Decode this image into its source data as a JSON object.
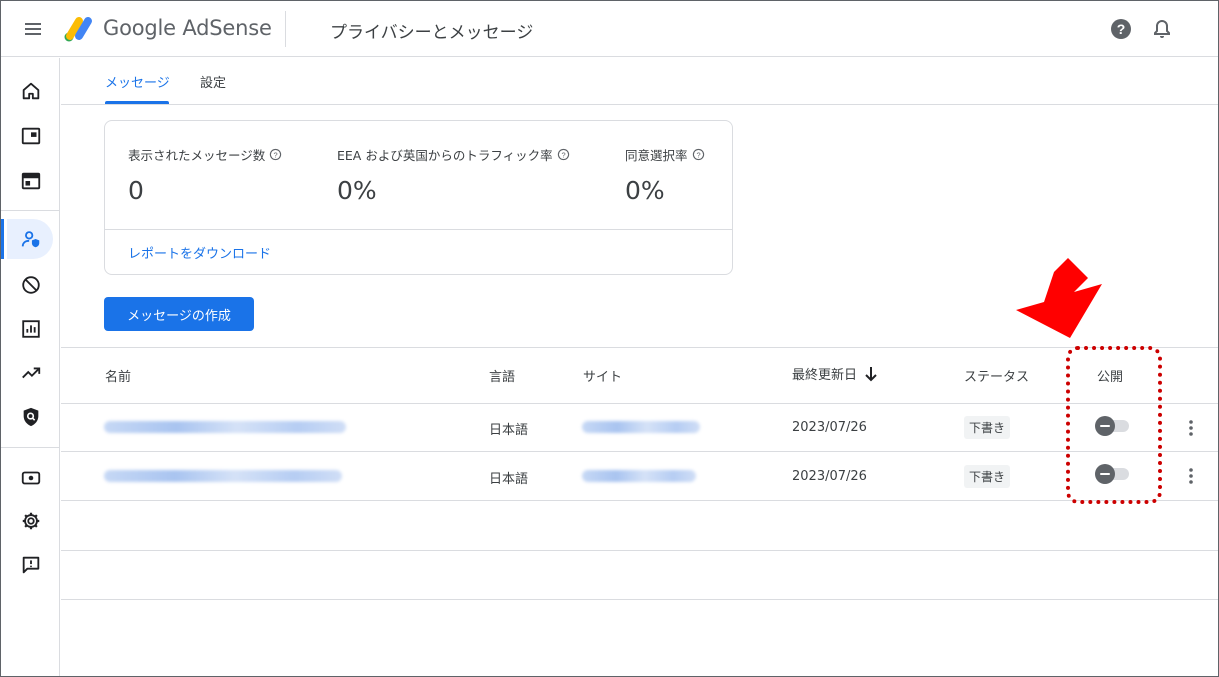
{
  "app": {
    "brand": "Google AdSense",
    "page_title": "プライバシーとメッセージ"
  },
  "tabs": [
    {
      "label": "メッセージ",
      "active": true
    },
    {
      "label": "設定",
      "active": false
    }
  ],
  "rail": {
    "items": [
      "home-icon",
      "ads-icon",
      "sites-icon",
      "privacy-messaging-icon",
      "blocking-controls-icon",
      "reports-icon",
      "optimization-icon",
      "policy-center-icon",
      "payments-icon",
      "settings-icon",
      "feedback-icon"
    ],
    "active": "privacy-messaging-icon"
  },
  "stats": [
    {
      "label": "表示されたメッセージ数",
      "value": "0"
    },
    {
      "label": "EEA および英国からのトラフィック率",
      "value": "0%"
    },
    {
      "label": "同意選択率",
      "value": "0%"
    }
  ],
  "download_link": "レポートをダウンロード",
  "create_button": "メッセージの作成",
  "table": {
    "headers": {
      "name": "名前",
      "language": "言語",
      "site": "サイト",
      "last_updated": "最終更新日",
      "status": "ステータス",
      "publish": "公開"
    },
    "sort": {
      "column": "last_updated",
      "direction": "descending"
    },
    "rows": [
      {
        "language": "日本語",
        "date": "2023/07/26",
        "status": "下書き",
        "published": false
      },
      {
        "language": "日本語",
        "date": "2023/07/26",
        "status": "下書き",
        "published": false
      }
    ]
  },
  "colors": {
    "accent": "#1a73e8",
    "annotation": "#cc0000",
    "arrow": "#ff0000"
  }
}
